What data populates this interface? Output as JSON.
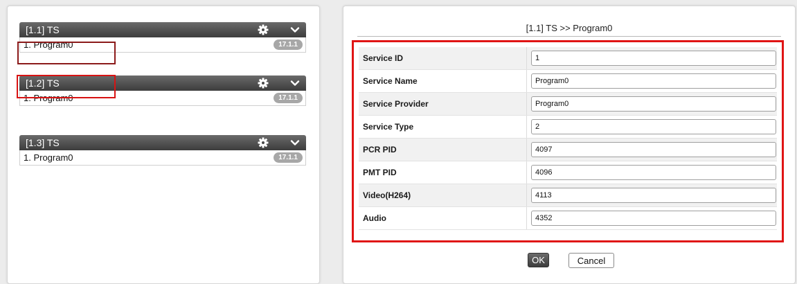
{
  "ts_groups": [
    {
      "header": "[1.1] TS",
      "program": "1. Program0",
      "badge": "17.1.1"
    },
    {
      "header": "[1.2] TS",
      "program": "1. Program0",
      "badge": "17.1.1"
    },
    {
      "header": "[1.3] TS",
      "program": "1. Program0",
      "badge": "17.1.1"
    }
  ],
  "dialog": {
    "title": "[1.1] TS >> Program0",
    "fields": [
      {
        "label": "Service ID",
        "value": "1"
      },
      {
        "label": "Service Name",
        "value": "Program0"
      },
      {
        "label": "Service Provider",
        "value": "Program0"
      },
      {
        "label": "Service Type",
        "value": "2"
      },
      {
        "label": "PCR PID",
        "value": "4097"
      },
      {
        "label": "PMT PID",
        "value": "4096"
      },
      {
        "label": "Video(H264)",
        "value": "4113"
      },
      {
        "label": "Audio",
        "value": "4352"
      }
    ],
    "ok_label": "OK",
    "cancel_label": "Cancel"
  },
  "icons": {
    "settings": "gear-icon",
    "expand": "chevron-down-icon"
  },
  "colors": {
    "highlight_red": "#e01414",
    "highlight_dark_red": "#8b1a1a",
    "header_dark": "#4a4a4a",
    "badge_gray": "#a7a7a7"
  }
}
